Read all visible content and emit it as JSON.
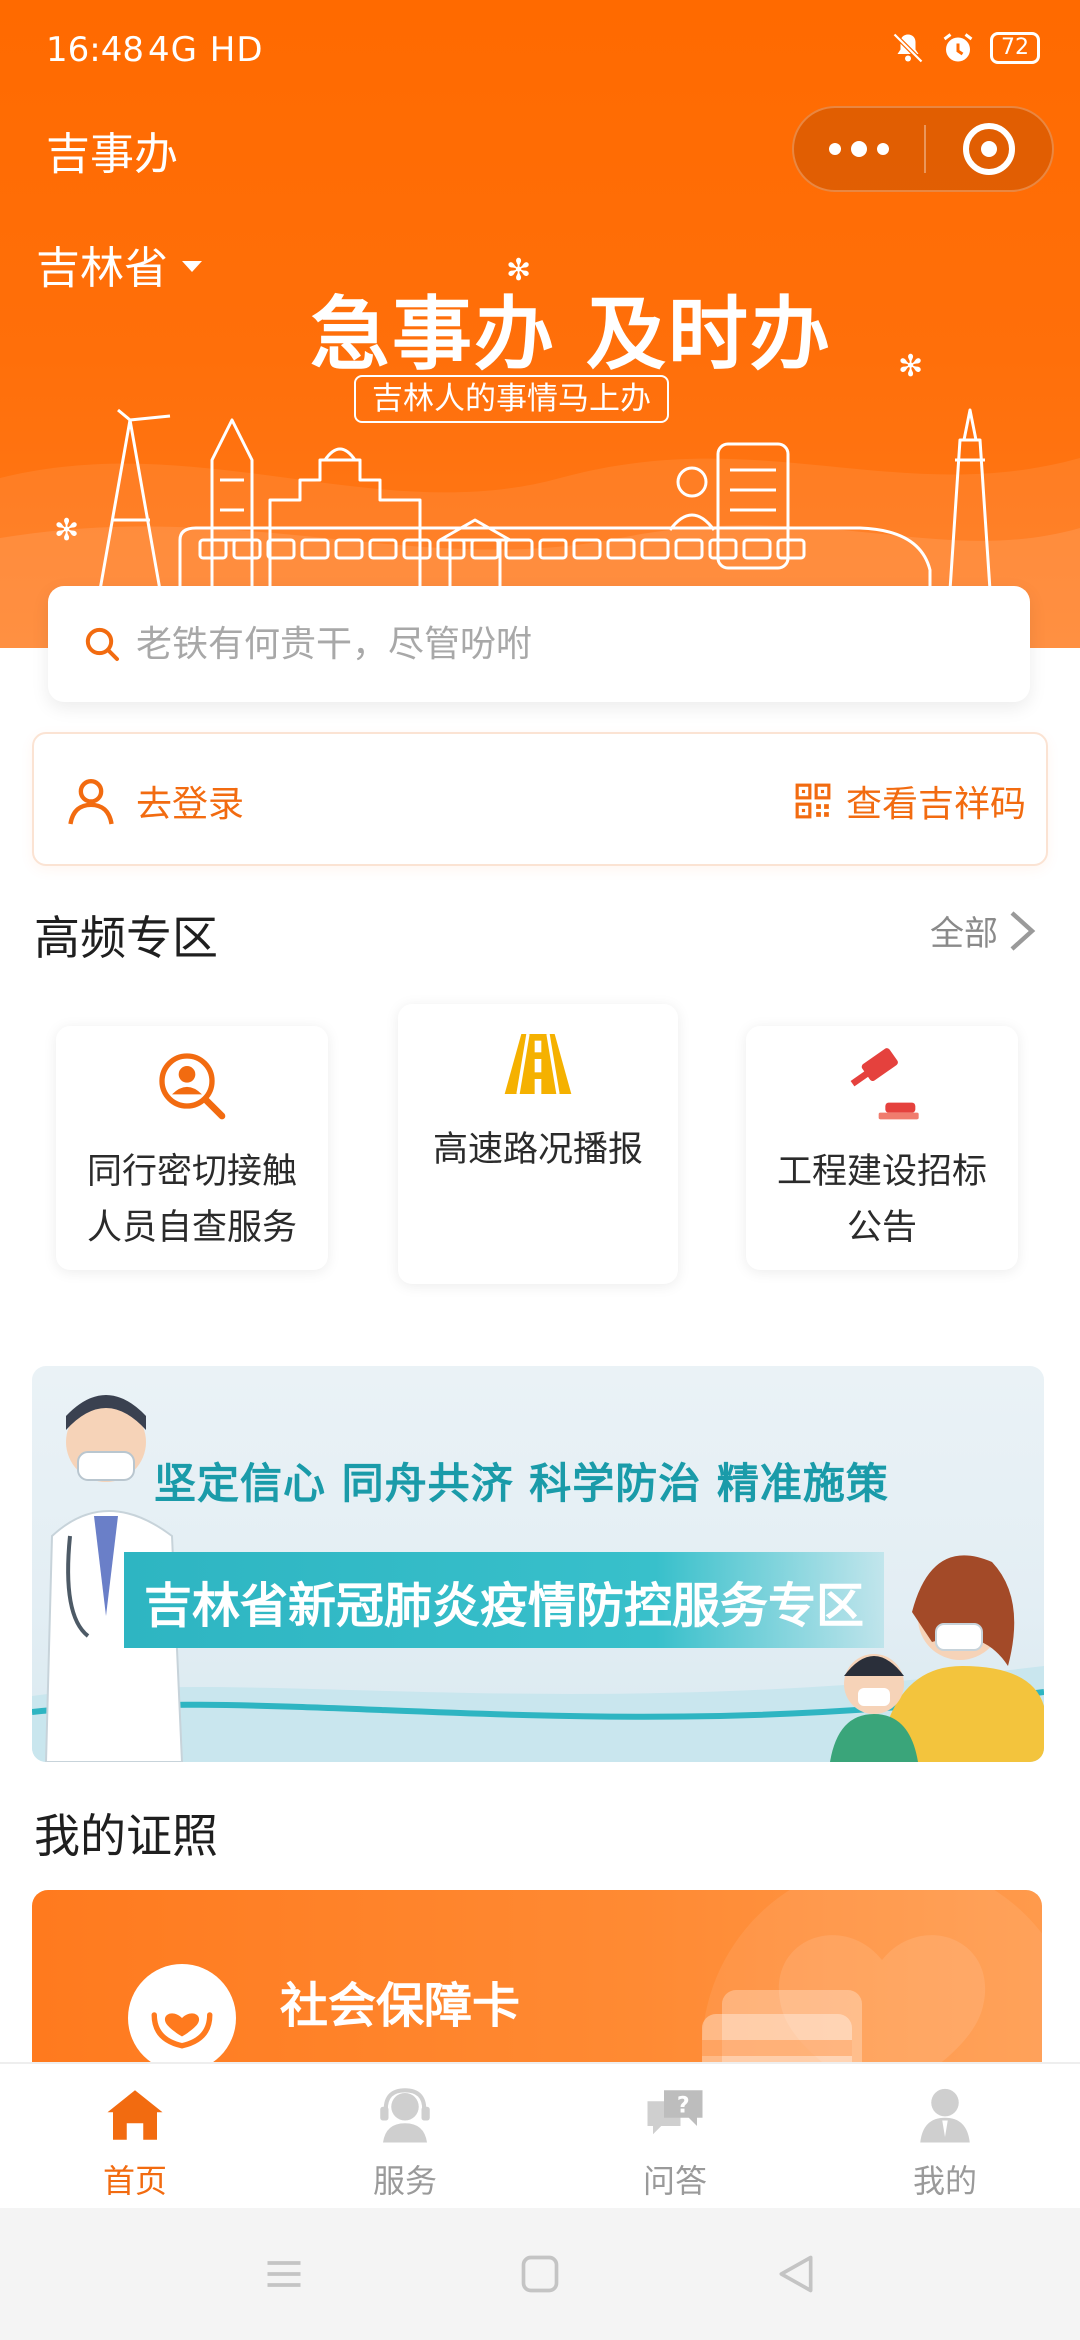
{
  "status_bar": {
    "time": "16:48",
    "network": "4G HD",
    "battery": "72"
  },
  "header": {
    "app_title": "吉事办",
    "province": "吉林省"
  },
  "hero": {
    "slogan": "急事办 及时办",
    "subtitle": "吉林人的事情马上办"
  },
  "search": {
    "placeholder": "老铁有何贵干，尽管吩咐"
  },
  "account": {
    "login_label": "去登录",
    "qrcode_label": "查看吉祥码"
  },
  "high_freq": {
    "title": "高频专区",
    "see_all": "全部",
    "items": [
      {
        "label": "同行密切接触人员自查服务",
        "icon": "person-search-icon"
      },
      {
        "label": "高速路况播报",
        "icon": "highway-icon"
      },
      {
        "label": "工程建设招标公告",
        "icon": "gavel-icon"
      }
    ]
  },
  "banner": {
    "line1": "坚定信心 同舟共济 科学防治 精准施策",
    "line2": "吉林省新冠肺炎疫情防控服务专区"
  },
  "certificates": {
    "title": "我的证照",
    "card_name": "社会保障卡"
  },
  "tabbar": {
    "tabs": [
      {
        "label": "首页",
        "icon": "home-icon",
        "active": true
      },
      {
        "label": "服务",
        "icon": "service-icon",
        "active": false
      },
      {
        "label": "问答",
        "icon": "qa-icon",
        "active": false
      },
      {
        "label": "我的",
        "icon": "profile-icon",
        "active": false
      }
    ]
  },
  "colors": {
    "brand": "#ff6a00",
    "accent_text": "#f26b10",
    "banner_teal": "#2eb5c2"
  }
}
